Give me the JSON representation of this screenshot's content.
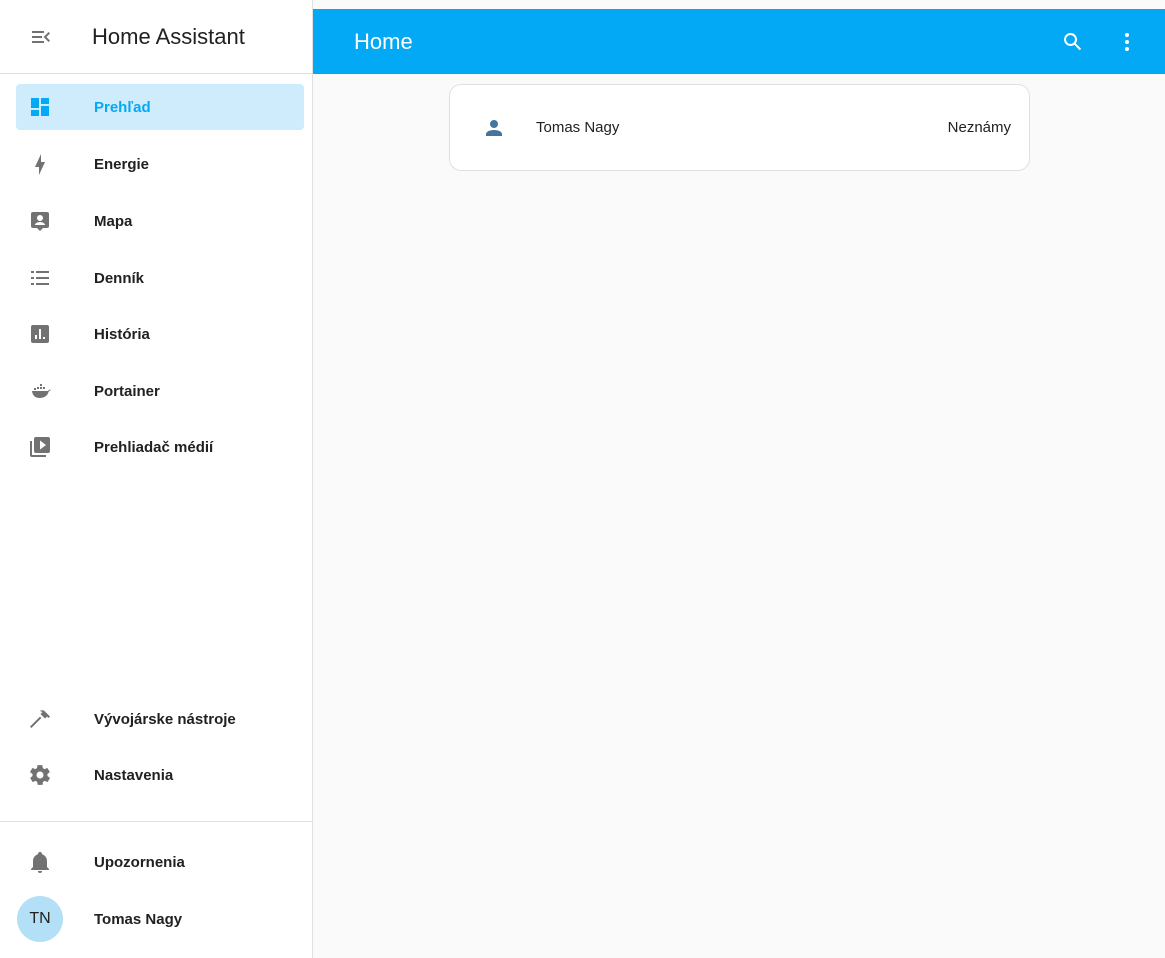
{
  "sidebar": {
    "app_title": "Home Assistant",
    "menu_icon": "menu-collapse-icon",
    "items": [
      {
        "label": "Prehľad",
        "icon": "view-dashboard-icon",
        "active": true
      },
      {
        "label": "Energie",
        "icon": "lightning-bolt-icon"
      },
      {
        "label": "Mapa",
        "icon": "account-box-marker-icon"
      },
      {
        "label": "Denník",
        "icon": "format-list-bulleted-icon"
      },
      {
        "label": "História",
        "icon": "chart-box-icon"
      },
      {
        "label": "Portainer",
        "icon": "docker-icon"
      },
      {
        "label": "Prehliadač médií",
        "icon": "play-box-multiple-icon"
      }
    ],
    "bottom_items": [
      {
        "label": "Vývojárske nástroje",
        "icon": "hammer-icon"
      },
      {
        "label": "Nastavenia",
        "icon": "cog-icon"
      }
    ],
    "notifications": {
      "label": "Upozornenia",
      "icon": "bell-icon"
    },
    "user": {
      "initials": "TN",
      "name": "Tomas Nagy"
    }
  },
  "appbar": {
    "title": "Home",
    "search_icon": "search-icon",
    "more_icon": "dots-vertical-icon"
  },
  "card": {
    "icon": "account-icon",
    "name": "Tomas Nagy",
    "state": "Neznámy"
  },
  "colors": {
    "accent": "#03a9f4",
    "active_bg": "#cfecfc",
    "icon_gray": "#727272",
    "person_icon": "#44739e"
  }
}
